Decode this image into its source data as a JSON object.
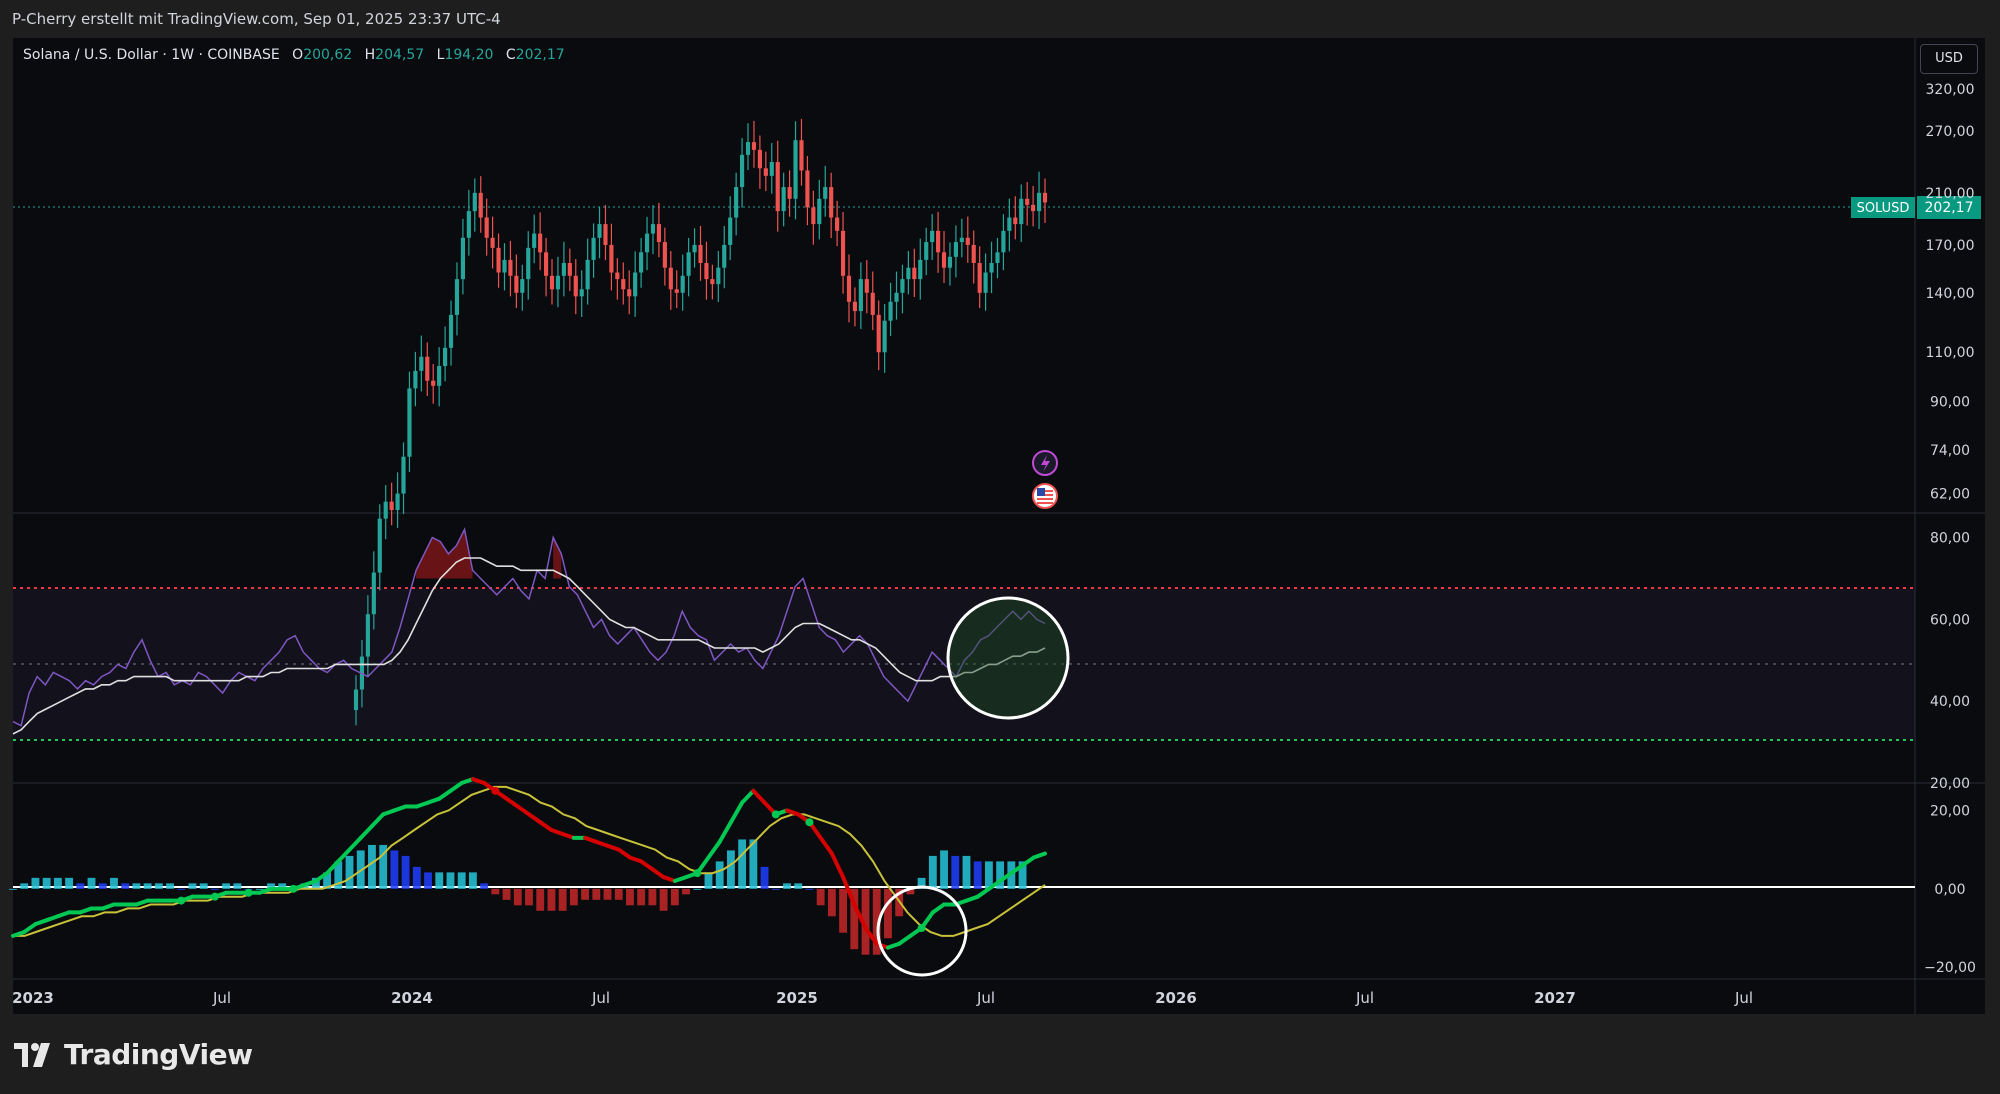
{
  "header": {
    "credit": "P-Cherry erstellt mit TradingView.com, Sep 01, 2025 23:37 UTC-4"
  },
  "symbol": {
    "name": "Solana / U.S. Dollar · 1W · COINBASE",
    "open_label": "O",
    "open": "200,62",
    "high_label": "H",
    "high": "204,57",
    "low_label": "L",
    "low": "194,20",
    "close_label": "C",
    "close": "202,17"
  },
  "currency_button": "USD",
  "price_badge": {
    "ticker": "SOLUSD",
    "value": "202,17"
  },
  "footer": {
    "logo_text": "TradingView"
  },
  "colors": {
    "up": "#26a69a",
    "down": "#ef5350",
    "rsi": "#7e57c2",
    "rsi_ma": "#e0e0e0",
    "macd_up": "#00c853",
    "macd_down": "#d50000",
    "signal": "#c8c23a",
    "hist_pos": "#26c6da",
    "hist_pos_weak": "#1e40ff",
    "hist_neg": "#c62828",
    "overbought": "#f23645",
    "oversold": "#22c55e",
    "badge": "#089981"
  },
  "icons": [
    "lightning-event-icon",
    "us-flag-event-icon"
  ],
  "chart_data": [
    {
      "type": "candlestick",
      "title": "Solana / U.S. Dollar · 1W · COINBASE",
      "y_scale": "log",
      "ylim": [
        58,
        360
      ],
      "y_ticks": [
        "320,00",
        "270,00",
        "210,00",
        "170,00",
        "140,00",
        "110,00",
        "90,00",
        "74,00",
        "62,00"
      ],
      "x_ticks": [
        "2023",
        "Jul",
        "2024",
        "Jul",
        "2025",
        "Jul",
        "2026",
        "Jul",
        "2027",
        "Jul"
      ],
      "last_price": 202.17,
      "weekly_closes_2023-10_to_2025-09": [
        28,
        32,
        38,
        45,
        56,
        60,
        58,
        62,
        72,
        95,
        102,
        108,
        98,
        96,
        104,
        112,
        128,
        148,
        175,
        195,
        210,
        190,
        175,
        168,
        152,
        160,
        150,
        140,
        148,
        168,
        178,
        165,
        150,
        142,
        150,
        158,
        150,
        138,
        142,
        160,
        175,
        185,
        170,
        152,
        148,
        142,
        138,
        152,
        165,
        178,
        185,
        172,
        155,
        142,
        140,
        150,
        165,
        170,
        158,
        148,
        145,
        155,
        170,
        190,
        215,
        245,
        258,
        250,
        232,
        225,
        238,
        195,
        215,
        205,
        260,
        230,
        198,
        185,
        205,
        215,
        190,
        180,
        150,
        135,
        130,
        148,
        140,
        128,
        110,
        125,
        135,
        140,
        148,
        155,
        148,
        160,
        172,
        180,
        165,
        155,
        162,
        172,
        175,
        170,
        158,
        140,
        152,
        158,
        165,
        180,
        190,
        185,
        205,
        200,
        195,
        210,
        202
      ]
    },
    {
      "type": "line",
      "title": "RSI",
      "y_ticks": [
        "80,00",
        "60,00",
        "40,00",
        "20,00"
      ],
      "ylim": [
        20,
        86
      ],
      "levels": [
        70,
        50,
        30
      ],
      "series": [
        {
          "values": [
            35,
            34,
            42,
            46,
            44,
            47,
            46,
            45,
            43,
            45,
            44,
            46,
            47,
            49,
            48,
            52,
            55,
            50,
            46,
            47,
            44,
            45,
            44,
            47,
            46,
            44,
            42,
            45,
            47,
            46,
            45,
            48,
            50,
            52,
            55,
            56,
            52,
            50,
            48,
            47,
            49,
            50,
            48,
            47,
            46,
            48,
            50,
            52,
            58,
            65,
            72,
            76,
            80,
            79,
            76,
            78,
            82,
            72,
            70,
            68,
            66,
            68,
            70,
            67,
            65,
            72,
            70,
            80,
            76,
            68,
            66,
            62,
            58,
            60,
            56,
            54,
            56,
            58,
            55,
            52,
            50,
            52,
            56,
            62,
            58,
            56,
            55,
            50,
            52,
            54,
            52,
            53,
            50,
            48,
            52,
            56,
            62,
            68,
            70,
            64,
            58,
            56,
            55,
            52,
            54,
            56,
            54,
            50,
            46,
            44,
            42,
            40,
            44,
            48,
            52,
            50,
            48,
            46,
            50,
            52,
            55,
            56,
            58,
            60,
            62,
            60,
            62,
            60,
            59
          ]
        },
        {
          "values": [
            32,
            33,
            35,
            37,
            38,
            39,
            40,
            41,
            42,
            43,
            43,
            44,
            44,
            45,
            45,
            46,
            46,
            46,
            46,
            46,
            45,
            45,
            45,
            45,
            45,
            45,
            45,
            45,
            45,
            46,
            46,
            46,
            47,
            47,
            48,
            48,
            48,
            48,
            48,
            48,
            49,
            49,
            49,
            49,
            49,
            49,
            49,
            50,
            52,
            55,
            59,
            63,
            67,
            70,
            72,
            74,
            75,
            75,
            75,
            74,
            73,
            73,
            73,
            72,
            72,
            72,
            72,
            72,
            71,
            70,
            68,
            66,
            64,
            62,
            60,
            59,
            58,
            58,
            57,
            56,
            55,
            55,
            55,
            55,
            55,
            55,
            54,
            53,
            53,
            53,
            53,
            53,
            53,
            52,
            53,
            54,
            56,
            58,
            59,
            59,
            59,
            58,
            57,
            56,
            55,
            55,
            54,
            53,
            51,
            49,
            47,
            46,
            45,
            45,
            45,
            46,
            46,
            46,
            47,
            47,
            48,
            49,
            49,
            50,
            51,
            51,
            52,
            52,
            53
          ]
        }
      ]
    },
    {
      "type": "line",
      "title": "MACD",
      "y_ticks": [
        "20,00",
        "0,00",
        "−20,00"
      ],
      "ylim": [
        -23,
        27
      ],
      "series": [
        {
          "values": [
            -12,
            -11,
            -9,
            -8,
            -7,
            -6,
            -6,
            -5,
            -5,
            -4,
            -4,
            -4,
            -3,
            -3,
            -3,
            -3,
            -2,
            -2,
            -2,
            -1,
            -1,
            -1,
            -1,
            0,
            0,
            0,
            1,
            2,
            4,
            7,
            10,
            13,
            16,
            19,
            20,
            21,
            21,
            22,
            23,
            25,
            27,
            28,
            27,
            25,
            23,
            21,
            19,
            17,
            15,
            14,
            13,
            13,
            12,
            11,
            10,
            8,
            7,
            5,
            3,
            2,
            3,
            4,
            8,
            12,
            17,
            22,
            25,
            22,
            19,
            20,
            19,
            17,
            13,
            9,
            3,
            -4,
            -10,
            -14,
            -15,
            -14,
            -12,
            -10,
            -6,
            -4,
            -4,
            -3,
            -2,
            0,
            2,
            4,
            6,
            8,
            9
          ]
        },
        {
          "values": [
            -12,
            -12,
            -11,
            -10,
            -9,
            -8,
            -7,
            -7,
            -6,
            -6,
            -5,
            -5,
            -4,
            -4,
            -4,
            -3,
            -3,
            -3,
            -2,
            -2,
            -2,
            -1,
            -1,
            -1,
            -1,
            0,
            0,
            0,
            1,
            2,
            4,
            6,
            8,
            11,
            13,
            15,
            17,
            19,
            20,
            22,
            24,
            25,
            26,
            26,
            25,
            24,
            22,
            21,
            19,
            18,
            16,
            15,
            14,
            13,
            12,
            11,
            10,
            8,
            7,
            5,
            4,
            4,
            5,
            7,
            10,
            13,
            16,
            18,
            19,
            19,
            18,
            17,
            16,
            14,
            11,
            7,
            2,
            -2,
            -6,
            -9,
            -11,
            -12,
            -12,
            -11,
            -10,
            -9,
            -7,
            -5,
            -3,
            -1,
            1
          ]
        }
      ]
    }
  ]
}
